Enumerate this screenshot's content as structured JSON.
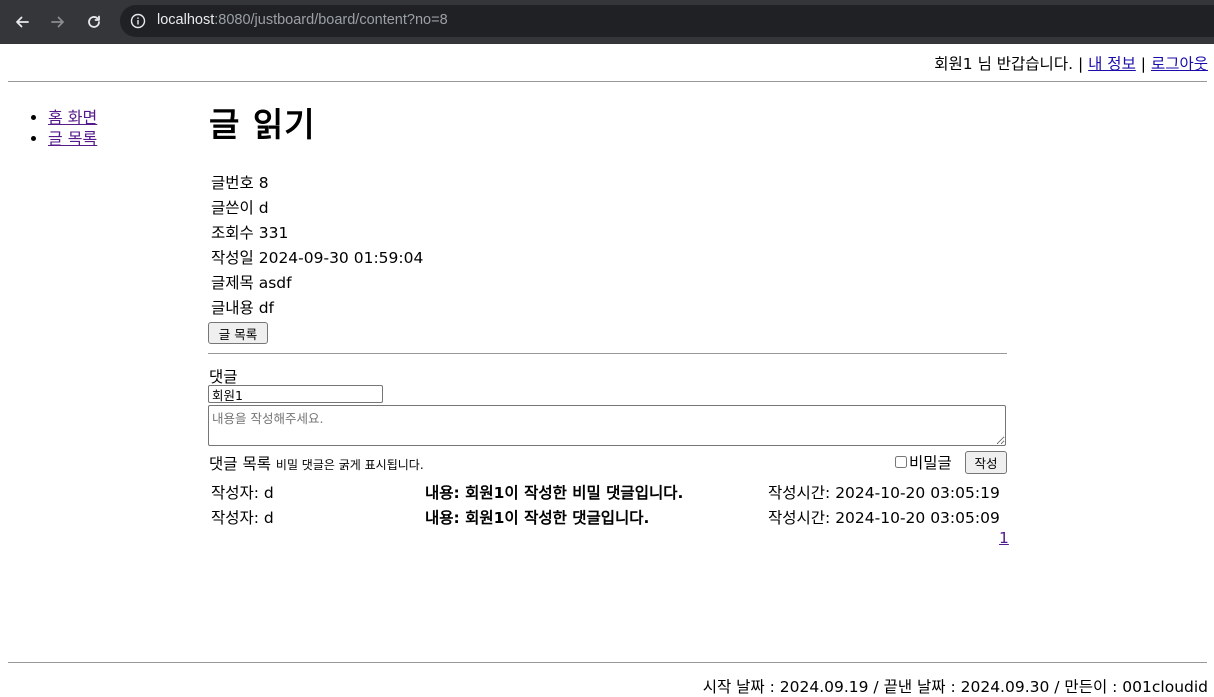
{
  "browser": {
    "url_host": "localhost",
    "url_path": ":8080/justboard/board/content?no=8"
  },
  "header": {
    "greeting": "회원1 님 반갑습니다.",
    "sep1": "|",
    "my_info": "내 정보",
    "sep2": "|",
    "logout": "로그아웃"
  },
  "sidebar": {
    "items": [
      {
        "label": "홈 화면"
      },
      {
        "label": "글 목록"
      }
    ]
  },
  "post": {
    "page_title": "글 읽기",
    "fields": [
      {
        "label": "글번호",
        "value": "8"
      },
      {
        "label": "글쓴이",
        "value": "d"
      },
      {
        "label": "조회수",
        "value": "331"
      },
      {
        "label": "작성일",
        "value": "2024-09-30 01:59:04"
      },
      {
        "label": "글제목",
        "value": "asdf"
      },
      {
        "label": "글내용",
        "value": "df"
      }
    ],
    "list_button": "글 목록"
  },
  "comment_form": {
    "heading": "댓글",
    "writer_value": "회원1",
    "body_placeholder": "내용을 작성해주세요.",
    "secret_label": "비밀글",
    "secret_checked": false,
    "submit_label": "작성"
  },
  "comments": {
    "heading": "댓글 목록",
    "note": "비밀 댓글은 굵게 표시됩니다.",
    "rows": [
      {
        "writer": "작성자: d",
        "content": "내용: 회원1이 작성한 비밀 댓글입니다.",
        "time": "작성시간: 2024-10-20 03:05:19"
      },
      {
        "writer": "작성자: d",
        "content": "내용: 회원1이 작성한 댓글입니다.",
        "time": "작성시간: 2024-10-20 03:05:09"
      }
    ],
    "pagination": [
      "1"
    ]
  },
  "footer": {
    "text": "시작 날짜 : 2024.09.19 / 끝낸 날짜 : 2024.09.30 / 만든이 : 001cloudid"
  }
}
